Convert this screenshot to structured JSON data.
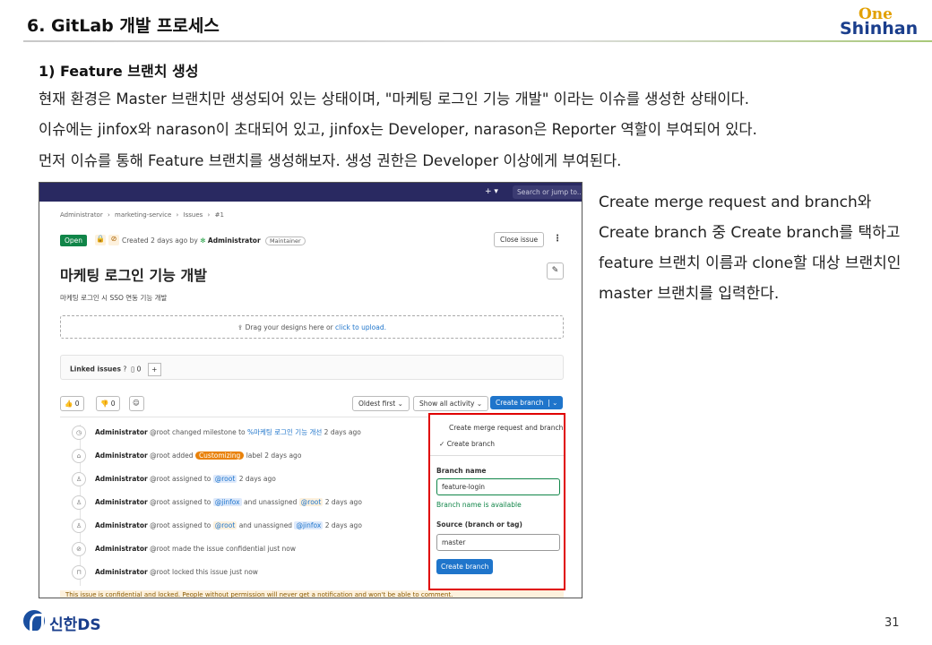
{
  "header": {
    "title": "6. GitLab 개발 프로세스",
    "logo_top": "One",
    "logo_bottom": "Shinhan"
  },
  "content": {
    "section_heading": "1) Feature 브랜치 생성",
    "paragraphs": [
      "현재 환경은 Master 브랜치만 생성되어 있는 상태이며, \"마케팅 로그인 기능 개발\" 이라는 이슈를 생성한 상태이다.",
      "이슈에는 jinfox와 narason이 초대되어 있고, jinfox는 Developer, narason은 Reporter 역할이 부여되어 있다.",
      "먼저 이슈를 통해 Feature 브랜치를 생성해보자. 생성 권한은 Developer 이상에게 부여된다."
    ],
    "side_note": "Create merge request and branch와 Create branch 중 Create branch를 택하고 feature 브랜치 이름과 clone할 대상 브랜치인 master 브랜치를 입력한다."
  },
  "screenshot": {
    "search_placeholder": "Search or jump to...",
    "plus_icon": "+ ▾",
    "breadcrumbs": [
      "Administrator",
      "›",
      "marketing-service",
      "›",
      "Issues",
      "›",
      "#1"
    ],
    "status": "Open",
    "created_prefix": "Created 2 days ago by",
    "author": "Administrator",
    "author_role": "Maintainer",
    "close_issue": "Close issue",
    "issue_title": "마케팅 로그인 기능 개발",
    "issue_description": "마케팅 로그인 시 SSO 연동 기능 개발",
    "dropzone_text": "Drag your designs here or",
    "dropzone_link": "click to upload.",
    "linked_issues_label": "Linked issues",
    "linked_issues_count": "0",
    "thumbs_up": "👍 0",
    "thumbs_down": "👎 0",
    "sort_label": "Oldest first",
    "filter_label": "Show all activity",
    "create_branch_button": "Create branch",
    "activities": [
      {
        "user": "Administrator",
        "handle": "@root",
        "text": "changed milestone to",
        "link": "%마케팅 로그인 기능 개선",
        "time": "2 days ago"
      },
      {
        "user": "Administrator",
        "handle": "@root",
        "text": "added",
        "badge": "Customizing",
        "text2": "label",
        "time": "2 days ago"
      },
      {
        "user": "Administrator",
        "handle": "@root",
        "text": "assigned to",
        "mention": "@root",
        "time": "2 days ago"
      },
      {
        "user": "Administrator",
        "handle": "@root",
        "text": "assigned to",
        "mention": "@jinfox",
        "text2": "and unassigned",
        "mention2": "@root",
        "time": "2 days ago"
      },
      {
        "user": "Administrator",
        "handle": "@root",
        "text": "assigned to",
        "mention": "@root",
        "text2": "and unassigned",
        "mention2": "@jinfox",
        "time": "2 days ago"
      },
      {
        "user": "Administrator",
        "handle": "@root",
        "text": "made the issue confidential just now"
      },
      {
        "user": "Administrator",
        "handle": "@root",
        "text": "locked this issue just now"
      }
    ],
    "banner": "This issue is confidential and locked. People without permission will never get a notification and won't be able to comment.",
    "dropdown": {
      "option1": "Create merge request and branch",
      "option2": "Create branch",
      "branch_name_label": "Branch name",
      "branch_name_value": "feature-login",
      "branch_available": "Branch name is available",
      "source_label": "Source (branch or tag)",
      "source_value": "master",
      "submit": "Create branch"
    }
  },
  "footer": {
    "company": "신한DS",
    "page": "31"
  }
}
